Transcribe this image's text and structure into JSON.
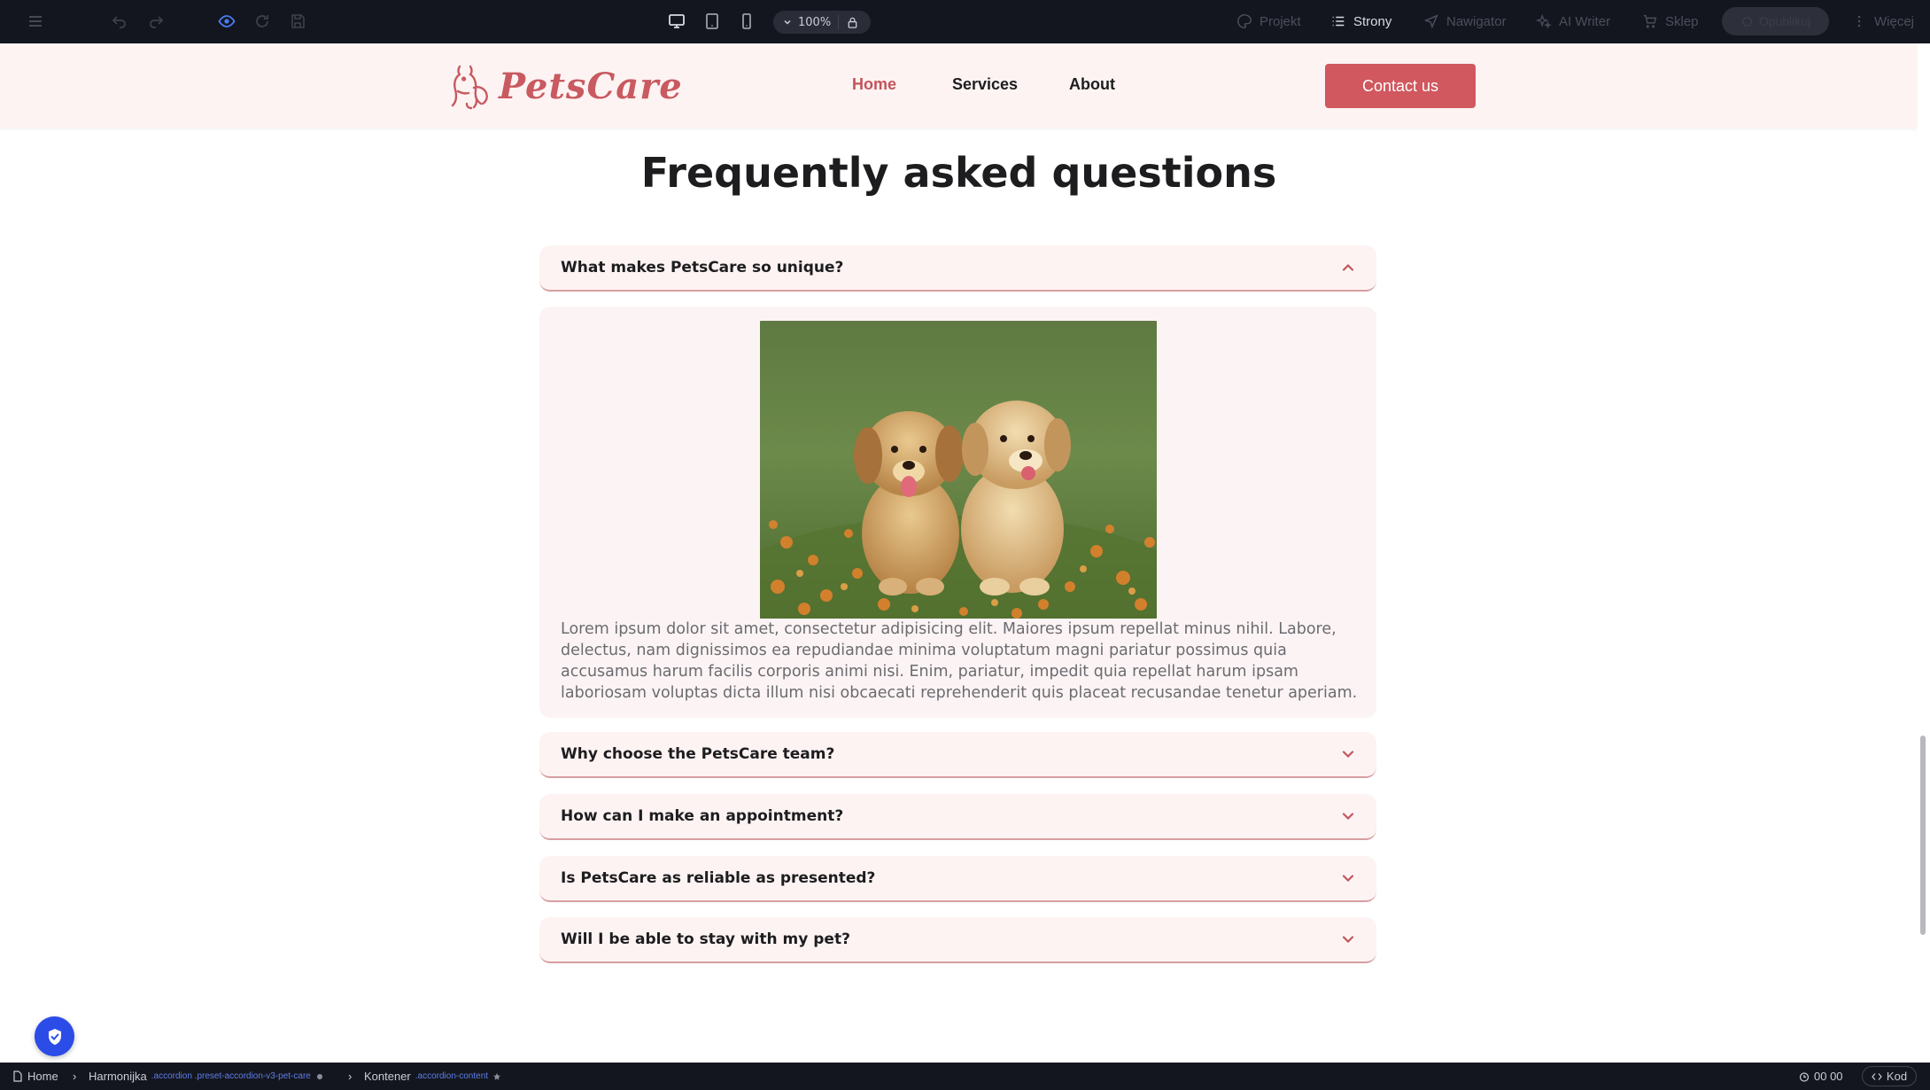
{
  "editor": {
    "zoom": "100%",
    "menu_items": {
      "projekt": "Projekt",
      "strony": "Strony",
      "nawigator": "Nawigator",
      "ai_writer": "AI Writer",
      "sklep": "Sklep",
      "publish": "Opublikuj",
      "wiecej": "Więcej"
    }
  },
  "site": {
    "logo_text": "PetsCare",
    "nav": [
      "Home",
      "Services",
      "About"
    ],
    "contact_label": "Contact us",
    "accent_color": "#d0585e"
  },
  "faq": {
    "title": "Frequently asked questions",
    "items": [
      "What makes PetsCare so unique?",
      "Why choose the PetsCare team?",
      "How can I make an appointment?",
      "Is PetsCare as reliable as presented?",
      "Will I be able to stay with my pet?"
    ],
    "open_answer": "Lorem ipsum dolor sit amet, consectetur adipisicing elit. Maiores ipsum repellat minus nihil. Labore, delectus, nam dignissimos ea repudiandae minima voluptatum magni pariatur possimus quia accusamus harum facilis corporis animi nisi. Enim, pariatur, impedit quia repellat harum ipsam laboriosam voluptas dicta illum nisi obcaecati reprehenderit quis placeat recusandae tenetur aperiam."
  },
  "breadcrumb": {
    "home": "Home",
    "harmonijka": "Harmonijka",
    "harmonijka_classes": ".accordion .preset-accordion-v3-pet-care",
    "kontener": "Kontener",
    "kontener_class": ".accordion-content"
  },
  "status": {
    "time": "00 00",
    "code_label": "Kod"
  }
}
